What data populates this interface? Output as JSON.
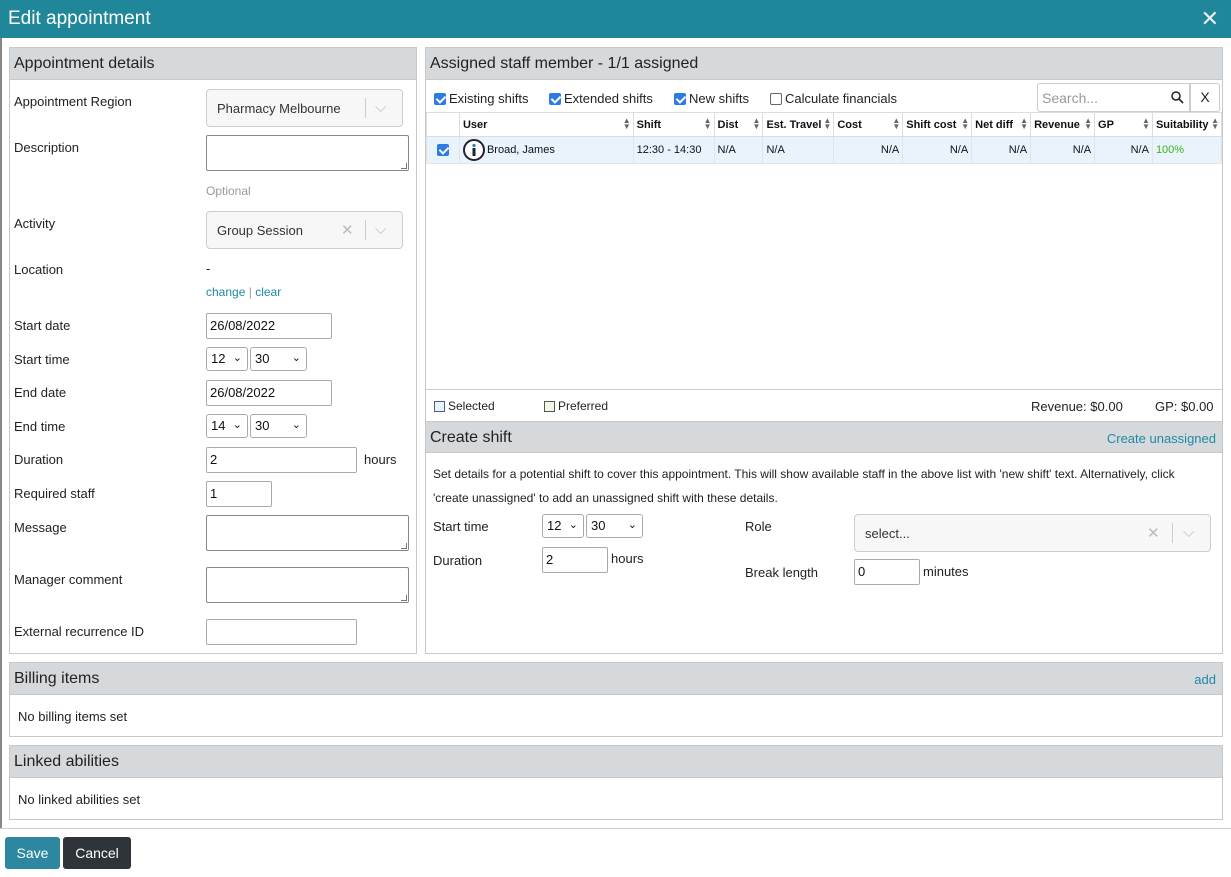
{
  "dialog": {
    "title": "Edit appointment",
    "close": "✕"
  },
  "details": {
    "heading": "Appointment details",
    "region_label": "Appointment Region",
    "region_value": "Pharmacy Melbourne",
    "description_label": "Description",
    "optional_hint": "Optional",
    "activity_label": "Activity",
    "activity_value": "Group Session",
    "location_label": "Location",
    "location_value": "-",
    "location_change": "change",
    "location_sep": "|",
    "location_clear": "clear",
    "start_date_label": "Start date",
    "start_date_value": "26/08/2022",
    "start_time_label": "Start time",
    "start_hour": "12",
    "start_min": "30",
    "end_date_label": "End date",
    "end_date_value": "26/08/2022",
    "end_time_label": "End time",
    "end_hour": "14",
    "end_min": "30",
    "duration_label": "Duration",
    "duration_value": "2",
    "duration_unit": "hours",
    "required_staff_label": "Required staff",
    "required_staff_value": "1",
    "message_label": "Message",
    "manager_comment_label": "Manager comment",
    "external_id_label": "External recurrence ID",
    "external_id_value": ""
  },
  "staff": {
    "heading": "Assigned staff member - 1/1 assigned",
    "filters": [
      {
        "label": "Existing shifts",
        "checked": true
      },
      {
        "label": "Extended shifts",
        "checked": true
      },
      {
        "label": "New shifts",
        "checked": true
      },
      {
        "label": "Calculate financials",
        "checked": false
      }
    ],
    "search_placeholder": "Search...",
    "search_clear": "X",
    "columns": [
      "User",
      "Shift",
      "Dist",
      "Est. Travel",
      "Cost",
      "Shift cost",
      "Net diff",
      "Revenue",
      "GP",
      "Suitability"
    ],
    "rows": [
      {
        "selected": true,
        "user": "Broad, James",
        "shift": "12:30 - 14:30",
        "dist": "N/A",
        "est_travel": "N/A",
        "cost": "N/A",
        "shift_cost": "N/A",
        "net_diff": "N/A",
        "revenue": "N/A",
        "gp": "N/A",
        "suitability": "100%"
      }
    ],
    "legend_selected": "Selected",
    "legend_preferred": "Preferred",
    "revenue_total": "Revenue: $0.00",
    "gp_total": "GP: $0.00"
  },
  "create_shift": {
    "heading": "Create shift",
    "create_unassigned": "Create unassigned",
    "help_line1": "Set details for a potential shift to cover this appointment. This will show available staff in the above list with 'new shift' text. Alternatively, click",
    "help_line2": "'create unassigned' to add an unassigned shift with these details.",
    "start_time_label": "Start time",
    "start_hour": "12",
    "start_min": "30",
    "duration_label": "Duration",
    "duration_value": "2",
    "duration_unit": "hours",
    "role_label": "Role",
    "role_placeholder": "select...",
    "break_label": "Break length",
    "break_value": "0",
    "break_unit": "minutes"
  },
  "billing": {
    "heading": "Billing items",
    "add": "add",
    "empty": "No billing items set"
  },
  "abilities": {
    "heading": "Linked abilities",
    "empty": "No linked abilities set"
  },
  "footer": {
    "save": "Save",
    "cancel": "Cancel"
  },
  "colors": {
    "titlebar": "#20879a",
    "link": "#1f8aa5",
    "save": "#2e87a0",
    "cancel": "#2f3438",
    "suitability": "#3fb618"
  }
}
